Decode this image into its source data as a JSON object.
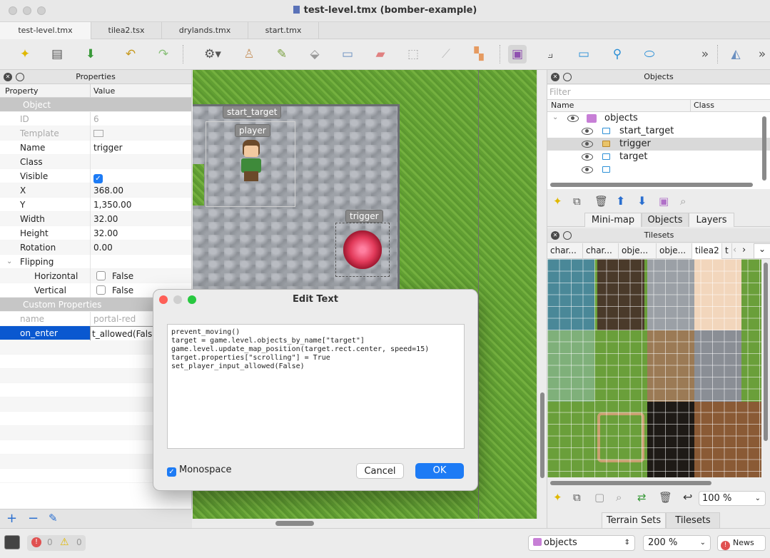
{
  "window": {
    "title": "test-level.tmx (bomber-example)"
  },
  "tabs": [
    "test-level.tmx",
    "tilea2.tsx",
    "drylands.tmx",
    "start.tmx"
  ],
  "properties_panel": {
    "title": "Properties",
    "col_property": "Property",
    "col_value": "Value",
    "group_object": "Object",
    "rows": [
      {
        "key": "ID",
        "value": "6"
      },
      {
        "key": "Template",
        "value": ""
      },
      {
        "key": "Name",
        "value": "trigger"
      },
      {
        "key": "Class",
        "value": ""
      },
      {
        "key": "Visible",
        "value": ""
      },
      {
        "key": "X",
        "value": "368.00"
      },
      {
        "key": "Y",
        "value": "1,350.00"
      },
      {
        "key": "Width",
        "value": "32.00"
      },
      {
        "key": "Height",
        "value": "32.00"
      },
      {
        "key": "Rotation",
        "value": "0.00"
      }
    ],
    "flipping": {
      "label": "Flipping",
      "horizontal": "Horizontal",
      "vertical": "Vertical",
      "false_label": "False"
    },
    "group_custom": "Custom Properties",
    "custom": [
      {
        "key": "name",
        "value": "portal-red"
      },
      {
        "key": "on_enter",
        "value": "t_allowed(Fals"
      }
    ]
  },
  "map": {
    "labels": {
      "start_target": "start_target",
      "player": "player",
      "trigger": "trigger"
    }
  },
  "objects_panel": {
    "title": "Objects",
    "filter_placeholder": "Filter",
    "col_name": "Name",
    "col_class": "Class",
    "layer": "objects",
    "items": [
      "start_target",
      "trigger",
      "target",
      ""
    ]
  },
  "mini_tabs": [
    "Mini-map",
    "Objects",
    "Layers"
  ],
  "tilesets_panel": {
    "title": "Tilesets",
    "tabs": [
      "char...",
      "char...",
      "obje...",
      "obje...",
      "tilea2",
      "t"
    ],
    "zoom": "100 %"
  },
  "bottom_tabs": [
    "Terrain Sets",
    "Tilesets"
  ],
  "status": {
    "errors": "0",
    "warnings": "0",
    "layer": "objects",
    "zoom": "200 %",
    "news": "News"
  },
  "dialog": {
    "title": "Edit Text",
    "text": "prevent_moving()\ntarget = game.level.objects_by_name[\"target\"]\ngame.level.update_map_position(target.rect.center, speed=15)\ntarget.properties[\"scrolling\"] = True\nset_player_input_allowed(False)",
    "monospace_label": "Monospace",
    "cancel": "Cancel",
    "ok": "OK"
  },
  "colors": {
    "accent": "#1d7bf5",
    "selection": "#0a58d0",
    "grass": "#6aa537"
  }
}
